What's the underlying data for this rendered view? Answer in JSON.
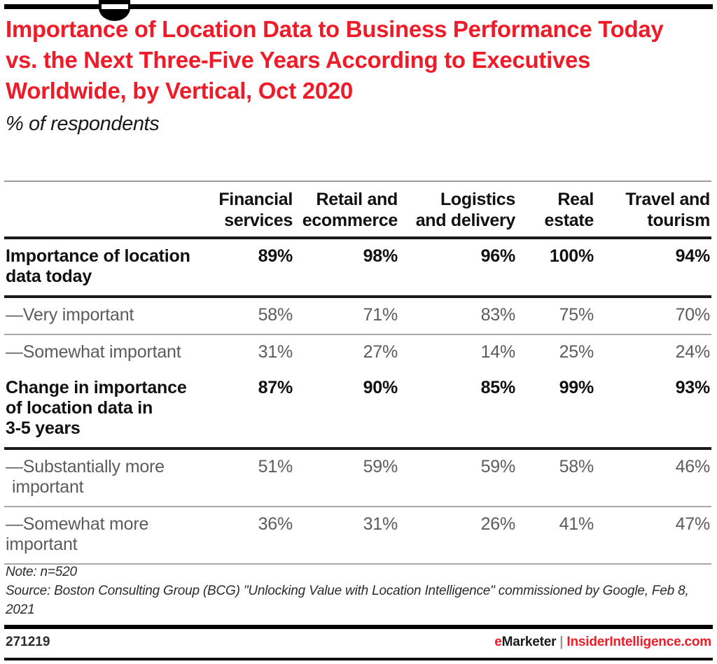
{
  "title": "Importance of Location Data to Business Performance Today vs. the Next Three-Five Years According to Executives Worldwide, by Vertical, Oct 2020",
  "subtitle": "% of respondents",
  "colors": {
    "accent_red": "#EE1C28",
    "title_red": "#EE1C28",
    "body_dark": "#111111",
    "sub_gray": "#5C5C5C",
    "rule_dark": "#1A1A1A",
    "rule_light": "#A8A8A8"
  },
  "notes": [
    "Note: n=520",
    "Source: Boston Consulting Group (BCG) \"Unlocking Value with Location Intelligence\" commissioned by Google, Feb 8, 2021"
  ],
  "footer": {
    "id": "271219",
    "brand_e": "e",
    "brand_name": "Marketer",
    "brand_pipe": "|",
    "brand_site": "InsiderIntelligence.com"
  },
  "chart_data": {
    "type": "table",
    "title": "Importance of Location Data to Business Performance Today vs. the Next Three-Five Years According to Executives Worldwide, by Vertical, Oct 2020",
    "subtitle": "% of respondents",
    "unit": "% of respondents",
    "row_header_label": "",
    "categories": [
      "Financial services",
      "Retail and ecommerce",
      "Logistics and delivery",
      "Real estate",
      "Travel and tourism"
    ],
    "column_headers": [
      {
        "line1": "Financial",
        "line2": "services"
      },
      {
        "line1": "Retail and",
        "line2": "ecommerce"
      },
      {
        "line1": "Logistics",
        "line2": "and delivery"
      },
      {
        "line1": "Real",
        "line2": "estate"
      },
      {
        "line1": "Travel and",
        "line2": "tourism"
      }
    ],
    "rows": [
      {
        "label_lines": [
          "Importance of location",
          "data today"
        ],
        "label": "Importance of location data today",
        "style": "group",
        "values": [
          "89%",
          "98%",
          "96%",
          "100%",
          "94%"
        ],
        "numeric": [
          89,
          98,
          96,
          100,
          94
        ]
      },
      {
        "label_lines": [
          "—Very important"
        ],
        "label": "—Very important",
        "style": "sub",
        "values": [
          "58%",
          "71%",
          "83%",
          "75%",
          "70%"
        ],
        "numeric": [
          58,
          71,
          83,
          75,
          70
        ]
      },
      {
        "label_lines": [
          "—Somewhat important"
        ],
        "label": "—Somewhat important",
        "style": "sub",
        "values": [
          "31%",
          "27%",
          "14%",
          "25%",
          "24%"
        ],
        "numeric": [
          31,
          27,
          14,
          25,
          24
        ]
      },
      {
        "label_lines": [
          "Change in importance",
          "of location data in",
          "3-5 years"
        ],
        "label": "Change in importance of location data in 3-5 years",
        "style": "group",
        "values": [
          "87%",
          "90%",
          "85%",
          "99%",
          "93%"
        ],
        "numeric": [
          87,
          90,
          85,
          99,
          93
        ]
      },
      {
        "label_lines": [
          "—Substantially more",
          "important"
        ],
        "label": "—Substantially more important",
        "style": "sub",
        "values": [
          "51%",
          "59%",
          "59%",
          "58%",
          "46%"
        ],
        "numeric": [
          51,
          59,
          59,
          58,
          46
        ]
      },
      {
        "label_lines": [
          "—Somewhat more",
          "important"
        ],
        "label": "—Somewhat more important",
        "style": "sub",
        "values": [
          "36%",
          "31%",
          "26%",
          "41%",
          "47%"
        ],
        "numeric": [
          36,
          31,
          26,
          41,
          47
        ]
      }
    ]
  }
}
